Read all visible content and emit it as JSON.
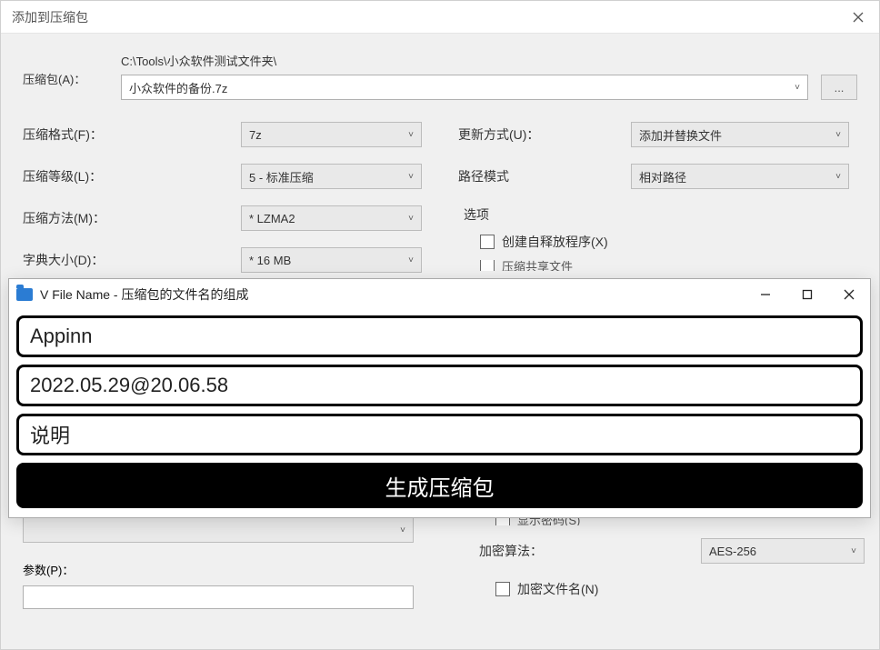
{
  "main": {
    "title": "添加到压缩包",
    "archive_label": "压缩包(A)：",
    "archive_path": "C:\\Tools\\小众软件测试文件夹\\",
    "archive_name": "小众软件的备份.7z",
    "browse_label": "...",
    "left_fields": {
      "format": {
        "label": "压缩格式(F)：",
        "value": "7z"
      },
      "level": {
        "label": "压缩等级(L)：",
        "value": "5 - 标准压缩"
      },
      "method": {
        "label": "压缩方法(M)：",
        "value": "* LZMA2"
      },
      "dict": {
        "label": "字典大小(D)：",
        "value": "* 16 MB"
      }
    },
    "right_fields": {
      "update": {
        "label": "更新方式(U)：",
        "value": "添加并替换文件"
      },
      "pathmode": {
        "label": "路径模式",
        "value": "相对路径"
      }
    },
    "options": {
      "heading": "选项",
      "sfx": "创建自释放程序(X)",
      "shared_partial": "压缩共享文件"
    },
    "bottom_left": {
      "params_label": "参数(P)："
    },
    "bottom_right": {
      "show_pwd_partial": "显示密码(S)",
      "encrypt_algo_label": "加密算法：",
      "encrypt_algo_value": "AES-256",
      "encrypt_names": "加密文件名(N)"
    }
  },
  "vfn": {
    "title": "V File Name - 压缩包的文件名的组成",
    "input1": "Appinn",
    "input2": "2022.05.29@20.06.58",
    "input3": "说明",
    "button": "生成压缩包"
  }
}
